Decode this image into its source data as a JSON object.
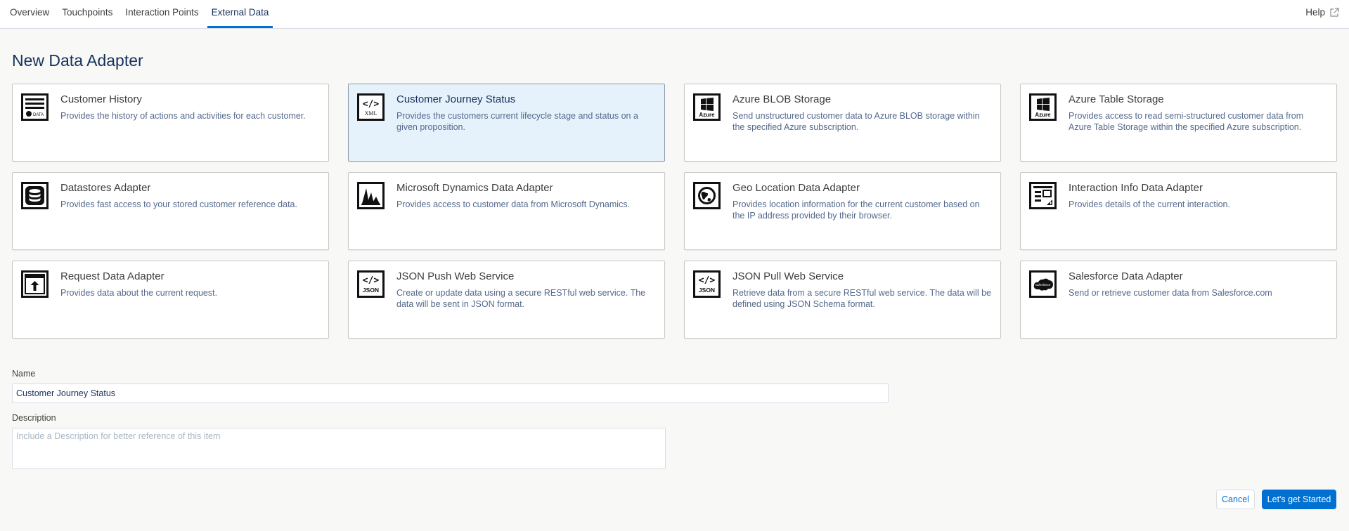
{
  "nav": {
    "tabs": [
      {
        "label": "Overview"
      },
      {
        "label": "Touchpoints"
      },
      {
        "label": "Interaction Points"
      },
      {
        "label": "External Data"
      }
    ],
    "active_tab": "External Data",
    "help_label": "Help"
  },
  "page": {
    "title": "New Data Adapter"
  },
  "adapters": [
    {
      "title": "Customer History",
      "description": "Provides the history of actions and activities for each customer.",
      "icon": "customer-history-icon",
      "icon_text": "DATA"
    },
    {
      "title": "Customer Journey Status",
      "description": "Provides the customers current lifecycle stage and status on a given proposition.",
      "icon": "xml-code-icon",
      "icon_text": "XML",
      "selected": true
    },
    {
      "title": "Azure BLOB Storage",
      "description": "Send unstructured customer data to Azure BLOB storage within the specified Azure subscription.",
      "icon": "azure-icon",
      "icon_text": "Azure"
    },
    {
      "title": "Azure Table Storage",
      "description": "Provides access to read semi-structured customer data from Azure Table Storage within the specified Azure subscription.",
      "icon": "azure-icon",
      "icon_text": "Azure"
    },
    {
      "title": "Datastores Adapter",
      "description": "Provides fast access to your stored customer reference data.",
      "icon": "database-icon"
    },
    {
      "title": "Microsoft Dynamics Data Adapter",
      "description": "Provides access to customer data from Microsoft Dynamics.",
      "icon": "dynamics-icon"
    },
    {
      "title": "Geo Location Data Adapter",
      "description": "Provides location information for the current customer based on the IP address provided by their browser.",
      "icon": "globe-icon"
    },
    {
      "title": "Interaction Info Data Adapter",
      "description": "Provides details of the current interaction.",
      "icon": "interaction-info-icon"
    },
    {
      "title": "Request Data Adapter",
      "description": "Provides data about the current request.",
      "icon": "request-upload-icon"
    },
    {
      "title": "JSON Push Web Service",
      "description": "Create or update data using a secure RESTful web service. The data will be sent in JSON format.",
      "icon": "json-code-icon",
      "icon_text": "JSON"
    },
    {
      "title": "JSON Pull Web Service",
      "description": "Retrieve data from a secure RESTful web service. The data will be defined using JSON Schema format.",
      "icon": "json-code-icon",
      "icon_text": "JSON"
    },
    {
      "title": "Salesforce Data Adapter",
      "description": "Send or retrieve customer data from Salesforce.com",
      "icon": "salesforce-cloud-icon",
      "icon_text": "salesforce"
    }
  ],
  "form": {
    "name_label": "Name",
    "name_value": "Customer Journey Status",
    "description_label": "Description",
    "description_placeholder": "Include a Description for better reference of this item"
  },
  "actions": {
    "cancel_label": "Cancel",
    "start_label": "Let's get Started"
  },
  "colors": {
    "accent": "#0070d2",
    "title": "#16325c",
    "selected_card": "#e6f2fb"
  }
}
